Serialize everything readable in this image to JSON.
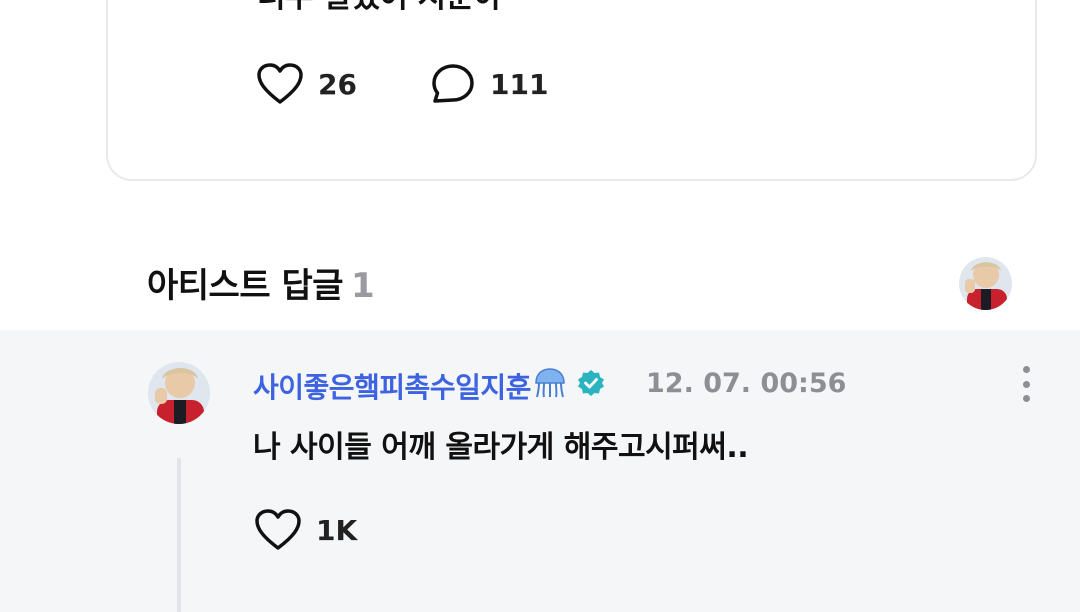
{
  "post": {
    "text": "너무 잘했어 지훈아",
    "like_count": "26",
    "comment_count": "111"
  },
  "artist_replies": {
    "title": "아티스트 답글",
    "count": "1"
  },
  "reply": {
    "author": "사이좋은햌피촉수일지훈",
    "emoji": "jellyfish-icon",
    "time": "12. 07. 00:56",
    "text": "나 사이들 어깨 올라가게 해주고시퍼써..",
    "like_count": "1K"
  },
  "colors": {
    "accent_name": "#3d63e0",
    "verified": "#2bb3c0",
    "section_bg": "#f5f6f8"
  }
}
